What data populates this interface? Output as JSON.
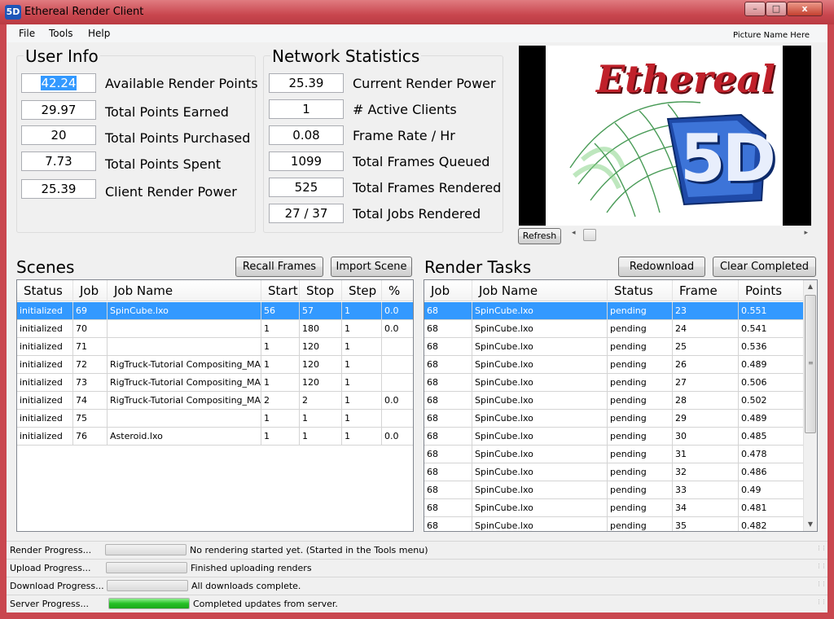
{
  "window": {
    "title": "Ethereal Render Client",
    "icon_text": "5D",
    "minimize": "–",
    "maximize": "□",
    "close": "x"
  },
  "menu": [
    "File",
    "Tools",
    "Help"
  ],
  "picture_name": "Picture Name Here",
  "user_info": {
    "title": "User Info",
    "fields": [
      {
        "value": "42.24",
        "label": "Available Render Points"
      },
      {
        "value": "29.97",
        "label": "Total Points Earned"
      },
      {
        "value": "20",
        "label": "Total Points Purchased"
      },
      {
        "value": "7.73",
        "label": "Total Points Spent"
      },
      {
        "value": "25.39",
        "label": "Client Render Power"
      }
    ]
  },
  "network": {
    "title": "Network Statistics",
    "fields": [
      {
        "value": "25.39",
        "label": "Current Render Power"
      },
      {
        "value": "1",
        "label": "# Active Clients"
      },
      {
        "value": "0.08",
        "label": "Frame Rate / Hr"
      },
      {
        "value": "1099",
        "label": "Total Frames Queued"
      },
      {
        "value": "525",
        "label": "Total Frames Rendered"
      },
      {
        "value": "27 / 37",
        "label": "Total Jobs Rendered"
      }
    ]
  },
  "preview": {
    "logo_word": "Ethereal",
    "logo_3d": "5D",
    "refresh_label": "Refresh"
  },
  "scenes": {
    "title": "Scenes",
    "recall_label": "Recall Frames",
    "import_label": "Import Scene",
    "columns": [
      "Status",
      "Job",
      "Job Name",
      "Start",
      "Stop",
      "Step",
      "%"
    ],
    "rows": [
      [
        "initialized",
        "69",
        "SpinCube.lxo",
        "56",
        "57",
        "1",
        "0.0"
      ],
      [
        "initialized",
        "70",
        "",
        "1",
        "180",
        "1",
        "0.0"
      ],
      [
        "initialized",
        "71",
        "",
        "1",
        "120",
        "1",
        ""
      ],
      [
        "initialized",
        "72",
        "RigTruck-Tutorial Compositing_MA.lxo",
        "1",
        "120",
        "1",
        ""
      ],
      [
        "initialized",
        "73",
        "RigTruck-Tutorial Compositing_MA.lxo",
        "1",
        "120",
        "1",
        ""
      ],
      [
        "initialized",
        "74",
        "RigTruck-Tutorial Compositing_MA.lxo",
        "2",
        "2",
        "1",
        "0.0"
      ],
      [
        "initialized",
        "75",
        "",
        "1",
        "1",
        "1",
        ""
      ],
      [
        "initialized",
        "76",
        "Asteroid.lxo",
        "1",
        "1",
        "1",
        "0.0"
      ]
    ]
  },
  "tasks": {
    "title": "Render Tasks",
    "redownload_label": "Redownload",
    "clear_label": "Clear Completed",
    "columns": [
      "Job",
      "Job Name",
      "Status",
      "Frame",
      "Points"
    ],
    "rows": [
      [
        "68",
        "SpinCube.lxo",
        "pending",
        "23",
        "0.551"
      ],
      [
        "68",
        "SpinCube.lxo",
        "pending",
        "24",
        "0.541"
      ],
      [
        "68",
        "SpinCube.lxo",
        "pending",
        "25",
        "0.536"
      ],
      [
        "68",
        "SpinCube.lxo",
        "pending",
        "26",
        "0.489"
      ],
      [
        "68",
        "SpinCube.lxo",
        "pending",
        "27",
        "0.506"
      ],
      [
        "68",
        "SpinCube.lxo",
        "pending",
        "28",
        "0.502"
      ],
      [
        "68",
        "SpinCube.lxo",
        "pending",
        "29",
        "0.489"
      ],
      [
        "68",
        "SpinCube.lxo",
        "pending",
        "30",
        "0.485"
      ],
      [
        "68",
        "SpinCube.lxo",
        "pending",
        "31",
        "0.478"
      ],
      [
        "68",
        "SpinCube.lxo",
        "pending",
        "32",
        "0.486"
      ],
      [
        "68",
        "SpinCube.lxo",
        "pending",
        "33",
        "0.49"
      ],
      [
        "68",
        "SpinCube.lxo",
        "pending",
        "34",
        "0.481"
      ],
      [
        "68",
        "SpinCube.lxo",
        "pending",
        "35",
        "0.482"
      ]
    ]
  },
  "progress": [
    {
      "label": "Render Progress...",
      "message": "No rendering started yet.  (Started in the Tools menu)",
      "fraction": 0
    },
    {
      "label": "Upload Progress...",
      "message": "Finished uploading renders",
      "fraction": 0
    },
    {
      "label": "Download Progress...",
      "message": "All downloads complete.",
      "fraction": 0
    },
    {
      "label": "Server Progress...",
      "message": "Completed updates from server.",
      "fraction": 1
    }
  ],
  "colors": {
    "selection": "#3399ff",
    "progress_green": "#26c026",
    "title_bar": "#c9474f"
  }
}
